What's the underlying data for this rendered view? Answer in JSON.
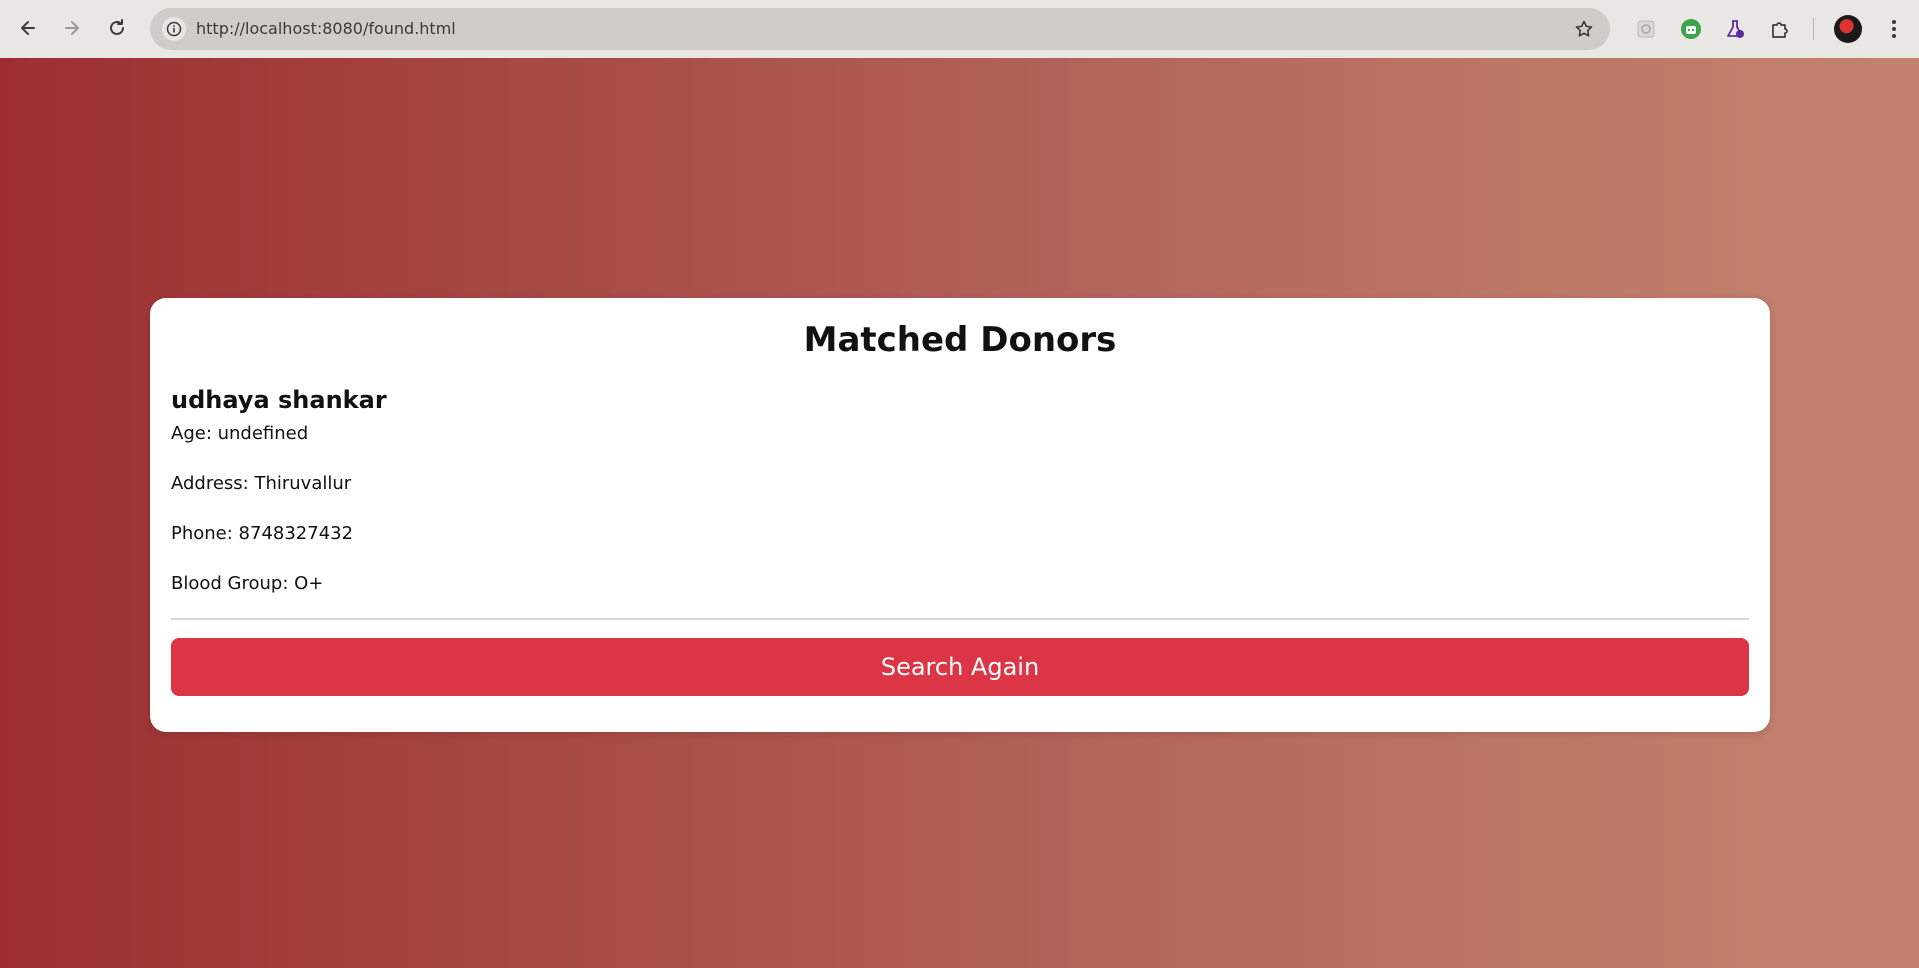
{
  "browser": {
    "url": "http://localhost:8080/found.html",
    "icons": {
      "back": "arrow-left-icon",
      "forward": "arrow-right-icon",
      "reload": "reload-icon",
      "site_info": "info-circle-icon",
      "bookmark": "star-icon",
      "extensions": [
        "sparkle-extension-icon",
        "robot-extension-icon",
        "flask-extension-icon",
        "puzzle-extension-icon"
      ],
      "menu": "vertical-dots-icon"
    }
  },
  "page": {
    "background_colors": [
      "#9c2e31",
      "#c2826f"
    ]
  },
  "card": {
    "title": "Matched Donors",
    "donors": [
      {
        "name": "udhaya shankar",
        "age": "Age: undefined",
        "address": "Address: Thiruvallur",
        "phone": "Phone: 8748327432",
        "blood_group": "Blood Group: O+"
      }
    ],
    "button_label": "Search Again",
    "button_color": "#dc3545"
  }
}
